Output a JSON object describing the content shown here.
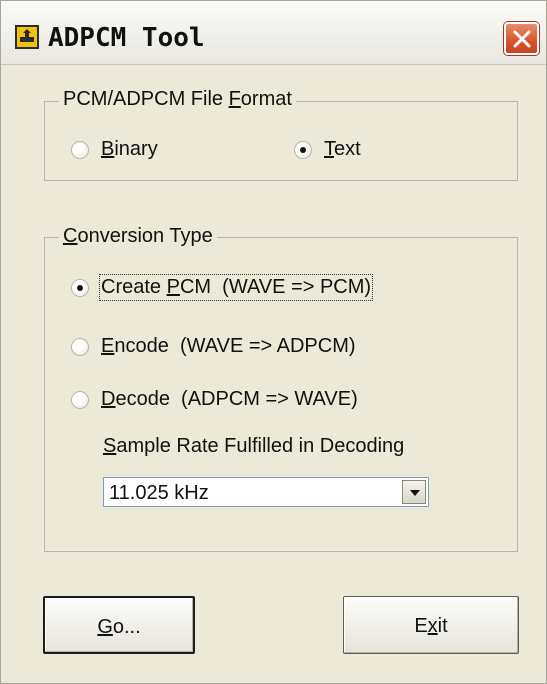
{
  "window": {
    "title": "ADPCM Tool",
    "app_icon": "adpcm-app-icon",
    "close_icon": "close-icon",
    "close_color": "#d9542d"
  },
  "file_format": {
    "legend_pre": "PCM/ADPCM File ",
    "legend_key": "F",
    "legend_post": "ormat",
    "options": [
      {
        "key": "B",
        "rest": "inary",
        "checked": false
      },
      {
        "key": "T",
        "rest": "ext",
        "checked": true
      }
    ]
  },
  "conversion": {
    "legend_key": "C",
    "legend_post": "onversion Type",
    "options": [
      {
        "pre": "Create ",
        "key": "P",
        "rest": "CM  (WAVE => PCM)",
        "checked": true
      },
      {
        "pre": "",
        "key": "E",
        "rest": "ncode  (WAVE => ADPCM)",
        "checked": false
      },
      {
        "pre": "",
        "key": "D",
        "rest": "ecode  (ADPCM => WAVE)",
        "checked": false
      }
    ],
    "sample_rate_label_key": "S",
    "sample_rate_label_rest": "ample Rate Fulfilled in Decoding",
    "sample_rate_value": "11.025 kHz"
  },
  "buttons": {
    "go_key": "G",
    "go_rest": "o...",
    "exit_pre": "E",
    "exit_key": "x",
    "exit_rest": "it"
  }
}
